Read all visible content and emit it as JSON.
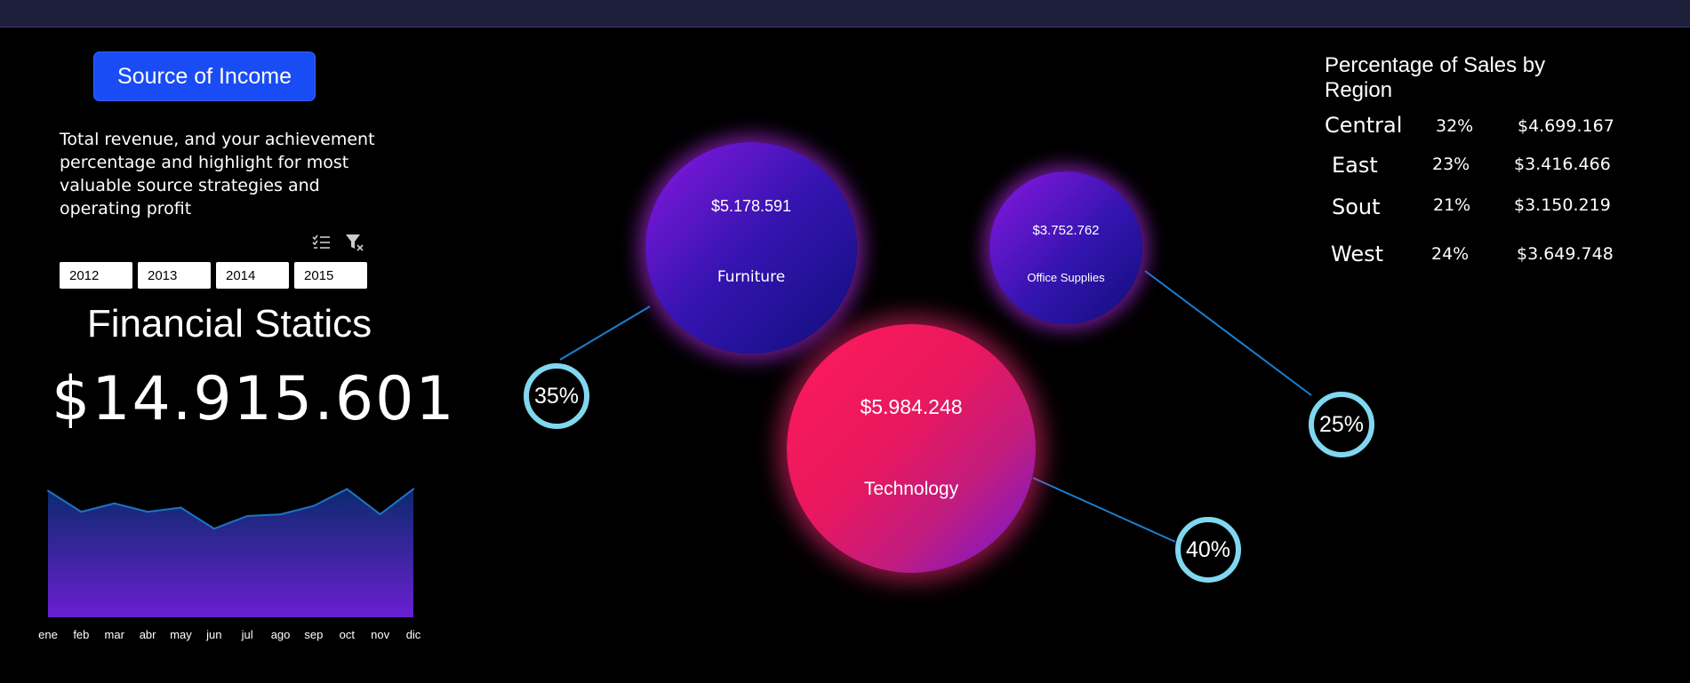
{
  "button": {
    "label": "Source of Income"
  },
  "description": {
    "line1": "Total revenue, and your achievement",
    "line2": "percentage and highlight for most",
    "line3": "valuable source strategies and",
    "line4": "operating profit"
  },
  "slicer": {
    "icons": [
      "multi-select-icon",
      "clear-filter-icon"
    ],
    "years": [
      "2012",
      "2013",
      "2014",
      "2015"
    ]
  },
  "financial": {
    "title": "Financial Statics",
    "total": "$14.915.601"
  },
  "chart_data": {
    "type": "area",
    "categories": [
      "ene",
      "feb",
      "mar",
      "abr",
      "may",
      "jun",
      "jul",
      "ago",
      "sep",
      "oct",
      "nov",
      "dic"
    ],
    "series": [
      {
        "values": [
          1.5,
          1.25,
          1.35,
          1.25,
          1.3,
          1.05,
          1.2,
          1.22,
          1.32,
          1.52,
          1.22,
          1.52
        ]
      }
    ],
    "ylim": [
      0,
      1.6
    ],
    "grid": false,
    "colors": {
      "line": "#1e74c6",
      "fill_top": "#0b2a6e",
      "fill_bottom": "#6a1fd0"
    }
  },
  "categories": {
    "furniture": {
      "value": "$5.178.591",
      "label": "Furniture",
      "pct": "35%"
    },
    "office": {
      "value": "$3.752.762",
      "label": "Office Supplies",
      "pct": "25%"
    },
    "technology": {
      "value": "$5.984.248",
      "label": "Technology",
      "pct": "40%"
    }
  },
  "regions": {
    "title": "Percentage of Sales by Region",
    "rows": [
      {
        "name": "Central",
        "pct": "32%",
        "value": "$4.699.167"
      },
      {
        "name": "East",
        "pct": "23%",
        "value": "$3.416.466"
      },
      {
        "name": "Sout",
        "pct": "21%",
        "value": "$3.150.219"
      },
      {
        "name": "West",
        "pct": "24%",
        "value": "$3.649.748"
      }
    ]
  },
  "colors": {
    "accent": "#1a4cf5",
    "ring": "#80d8f0",
    "background": "#000000"
  }
}
